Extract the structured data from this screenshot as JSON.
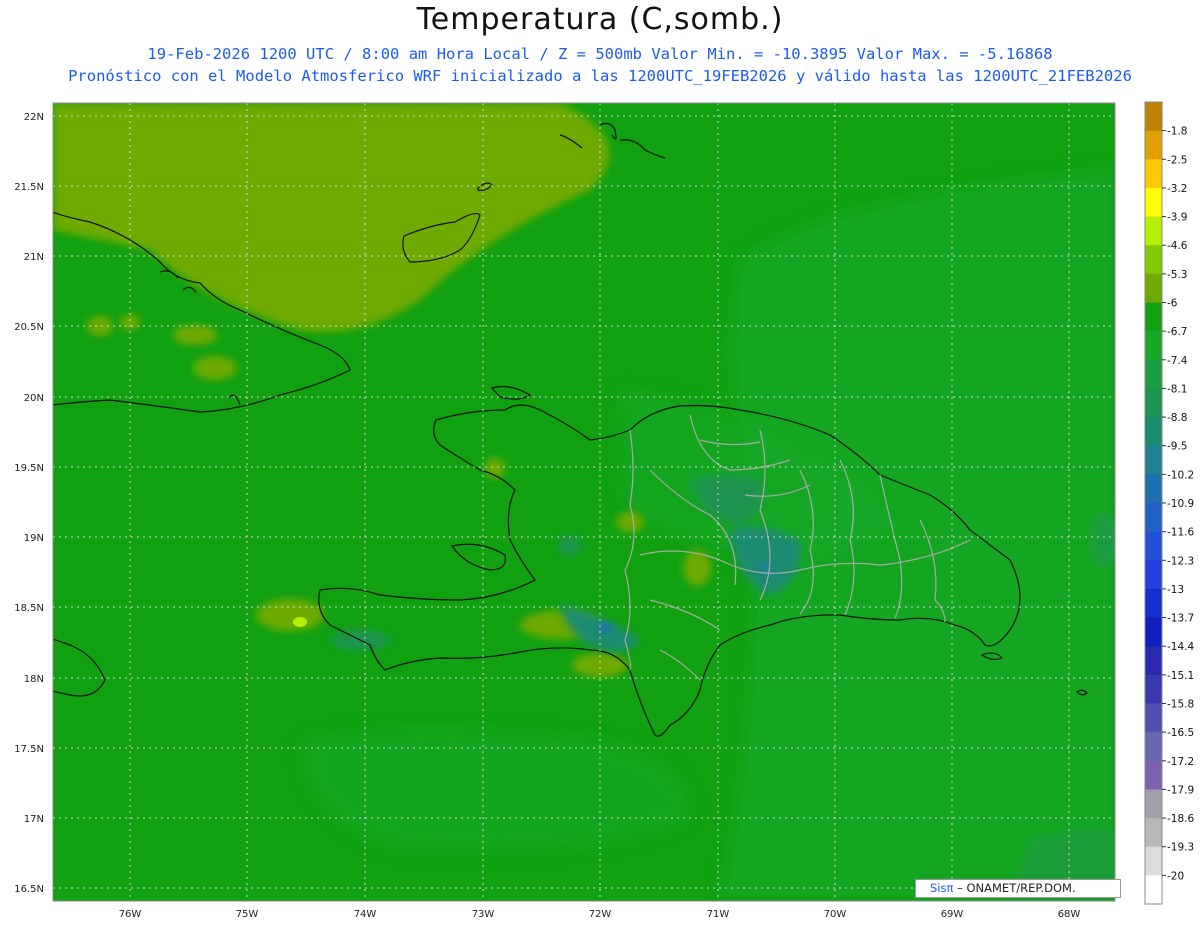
{
  "header": {
    "title": "Temperatura (C,somb.)",
    "subtitle_line1": "19-Feb-2026  1200 UTC / 8:00 am Hora Local / Z = 500mb  Valor Min. = -10.3895  Valor Max. = -5.16868",
    "subtitle_line2": "Pronóstico con el Modelo Atmosferico WRF inicializado a las 1200UTC_19FEB2026 y válido hasta las  1200UTC_21FEB2026"
  },
  "map": {
    "lat_labels": [
      "22N",
      "21.5N",
      "21N",
      "20.5N",
      "20N",
      "19.5N",
      "19N",
      "18.5N",
      "18N",
      "17.5N",
      "17N",
      "16.5N"
    ],
    "lon_labels": [
      "76W",
      "75W",
      "74W",
      "73W",
      "72W",
      "71W",
      "70W",
      "69W",
      "68W"
    ],
    "gridlines": "dotted"
  },
  "colorbar": {
    "levels": [
      "-1.8",
      "-2.5",
      "-3.2",
      "-3.9",
      "-4.6",
      "-5.3",
      "-6",
      "-6.7",
      "-7.4",
      "-8.1",
      "-8.8",
      "-9.5",
      "-10.2",
      "-10.9",
      "-11.6",
      "-12.3",
      "-13",
      "-13.7",
      "-14.4",
      "-15.1",
      "-15.8",
      "-16.5",
      "-17.2",
      "-17.9",
      "-18.6",
      "-19.3",
      "-20"
    ],
    "colors": [
      "#c08000",
      "#e0a000",
      "#ffc800",
      "#ffff00",
      "#b4f000",
      "#82c800",
      "#6eaa00",
      "#10a010",
      "#18a828",
      "#1a9c40",
      "#1a9450",
      "#1a8c70",
      "#208090",
      "#2070b0",
      "#2060c8",
      "#2050d8",
      "#2040e0",
      "#1030d0",
      "#1020c0",
      "#2828b0",
      "#3838b0",
      "#5050b0",
      "#6868b0",
      "#8060b0",
      "#a0a0a8",
      "#b8b8b8",
      "#dcdcdc",
      "#ffffff"
    ]
  },
  "credit": {
    "brand": "Sisπ",
    "text": "– ONAMET/REP.DOM."
  }
}
